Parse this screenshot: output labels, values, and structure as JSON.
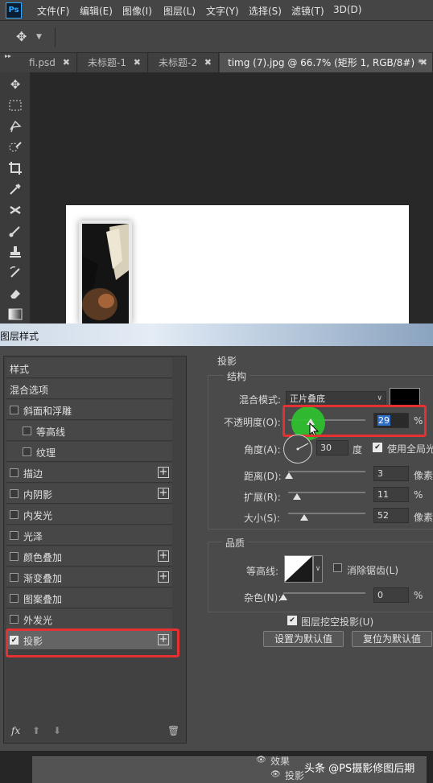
{
  "app": {
    "logo": "Ps"
  },
  "menu": [
    "文件(F)",
    "编辑(E)",
    "图像(I)",
    "图层(L)",
    "文字(Y)",
    "选择(S)",
    "滤镜(T)",
    "3D(D)"
  ],
  "tabs": [
    {
      "label": "fi.psd",
      "close": "✖"
    },
    {
      "label": "未标题-1",
      "close": "✖"
    },
    {
      "label": "未标题-2",
      "close": "✖"
    },
    {
      "label": "timg (7).jpg @ 66.7% (矩形 1, RGB/8#) *",
      "close": "✖"
    }
  ],
  "tools": [
    "move-icon",
    "marquee-icon",
    "lasso-icon",
    "quick-select-icon",
    "crop-icon",
    "eyedropper-icon",
    "healing-icon",
    "brush-icon",
    "stamp-icon",
    "history-brush-icon",
    "eraser-icon",
    "gradient-icon"
  ],
  "dialog": {
    "title": "图层样式",
    "list_header": "样式",
    "blend_options": "混合选项",
    "items": [
      {
        "label": "斜面和浮雕",
        "checked": false,
        "plus": false,
        "indent": 0
      },
      {
        "label": "等高线",
        "checked": false,
        "plus": false,
        "indent": 1
      },
      {
        "label": "纹理",
        "checked": false,
        "plus": false,
        "indent": 1
      },
      {
        "label": "描边",
        "checked": false,
        "plus": true,
        "indent": 0
      },
      {
        "label": "内阴影",
        "checked": false,
        "plus": true,
        "indent": 0
      },
      {
        "label": "内发光",
        "checked": false,
        "plus": false,
        "indent": 0
      },
      {
        "label": "光泽",
        "checked": false,
        "plus": false,
        "indent": 0
      },
      {
        "label": "颜色叠加",
        "checked": false,
        "plus": true,
        "indent": 0
      },
      {
        "label": "渐变叠加",
        "checked": false,
        "plus": true,
        "indent": 0
      },
      {
        "label": "图案叠加",
        "checked": false,
        "plus": false,
        "indent": 0
      },
      {
        "label": "外发光",
        "checked": false,
        "plus": false,
        "indent": 0
      },
      {
        "label": "投影",
        "checked": true,
        "plus": true,
        "indent": 0
      }
    ],
    "footer": {
      "fx": "fx",
      "up": "⬆",
      "down": "⬇",
      "trash": "🗑"
    },
    "settings": {
      "section": "投影",
      "structure": "结构",
      "blend_mode_label": "混合模式:",
      "blend_mode_value": "正片叠底",
      "shadow_color": "#000000",
      "opacity_label": "不透明度(O):",
      "opacity_value": "29",
      "opacity_fraction": 0.29,
      "percent": "%",
      "angle_label": "角度(A):",
      "angle_value": "30",
      "degree": "度",
      "global_light": "使用全局光",
      "global_light_checked": true,
      "distance_label": "距离(D):",
      "distance_value": "3",
      "distance_fraction": 0.01,
      "pixels": "像素",
      "spread_label": "扩展(R):",
      "spread_value": "11",
      "spread_fraction": 0.11,
      "size_label": "大小(S):",
      "size_value": "52",
      "size_fraction": 0.21,
      "quality": "品质",
      "contour_label": "等高线:",
      "antialias": "消除锯齿(L)",
      "noise_label": "杂色(N):",
      "noise_value": "0",
      "noise_fraction": 0.0,
      "knockout": "图层挖空投影(U)",
      "knockout_checked": true,
      "make_default": "设置为默认值",
      "reset_default": "复位为默认值"
    }
  },
  "layers": {
    "effects": "效果",
    "drop_shadow": "投影"
  },
  "watermark": "头条 @PS摄影修图后期"
}
